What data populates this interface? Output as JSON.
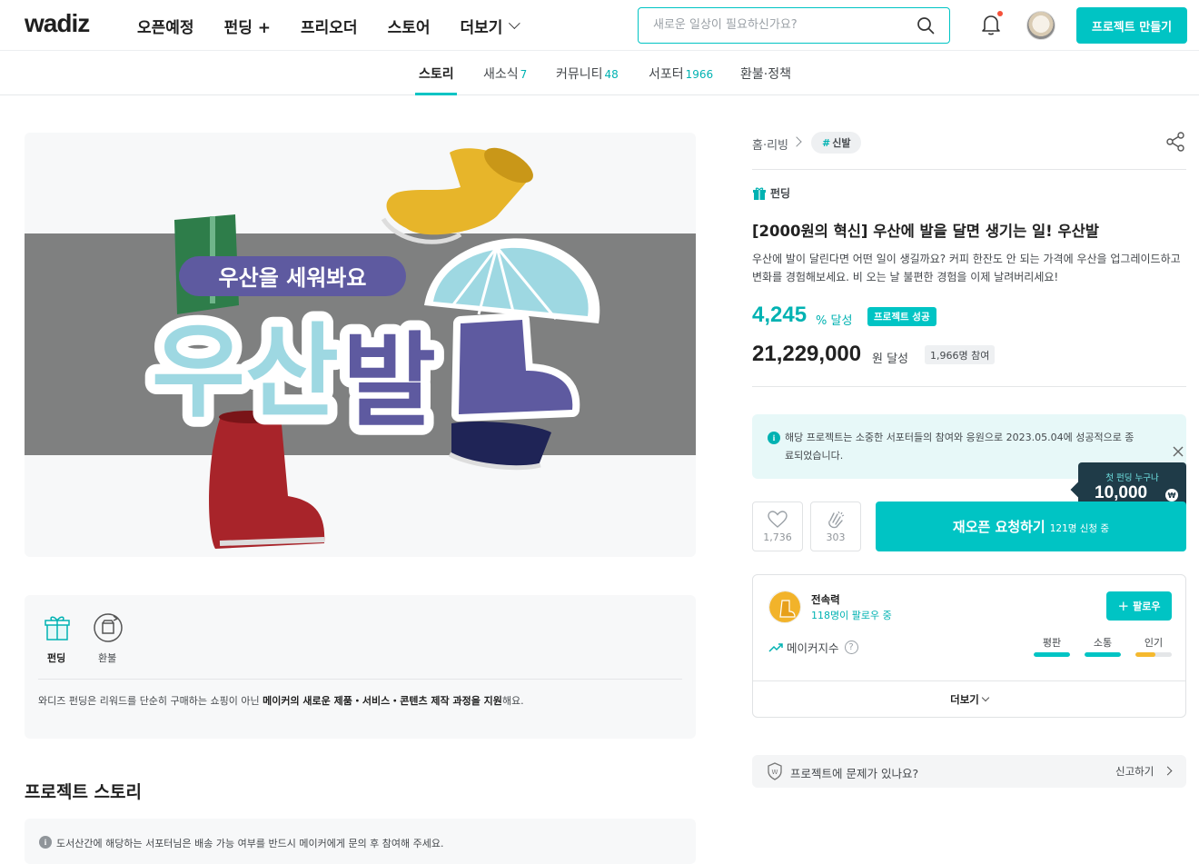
{
  "header": {
    "logo": "wadiz",
    "nav": [
      "오픈예정",
      "펀딩 +",
      "프리오더",
      "스토어",
      "더보기"
    ],
    "search_placeholder": "새로운 일상이 필요하신가요?",
    "make_project_label": "프로젝트 만들기"
  },
  "tabs": [
    {
      "label": "스토리",
      "count": ""
    },
    {
      "label": "새소식",
      "count": "7"
    },
    {
      "label": "커뮤니티",
      "count": "48"
    },
    {
      "label": "서포터",
      "count": "1966"
    },
    {
      "label": "환불·정책",
      "count": ""
    }
  ],
  "hero": {
    "badge_text": "우산을 세워봐요",
    "logo_text": "우산발"
  },
  "infobox": {
    "items": [
      "펀딩",
      "환불"
    ],
    "text_pre": "와디즈 펀딩은 리워드를 단순히 구매하는 쇼핑이 아닌 ",
    "text_bold": "메이커의 새로운 제품・서비스・콘텐츠 제작 과정을 지원",
    "text_post": "해요."
  },
  "story": {
    "title": "프로젝트 스토리",
    "notice": "도서산간에 해당하는 서포터님은 배송 가능 여부를 반드시 메이커에게 문의 후 참여해 주세요."
  },
  "project": {
    "breadcrumb": "홈·리빙",
    "tag": "신발",
    "category": "펀딩",
    "title": "[2000원의 혁신] 우산에 발을 달면 생기는 일! 우산발",
    "description": "우산에 발이 달린다면 어떤 일이 생길까요? 커피 한잔도 안 되는 가격에 우산을 업그레이드하고 변화를 경험해보세요. 비 오는 날 불편한 경험을 이제 날려버리세요!",
    "percent": "4,245",
    "percent_unit": "% 달성",
    "success_badge": "프로젝트 성공",
    "amount": "21,229,000",
    "amount_unit": "원 달성",
    "participants": "1,966명 참여",
    "done_notice": "해당 프로젝트는 소중한 서포터들의 참여와 응원으로 2023.05.04에 성공적으로 종료되었습니다.",
    "tooltip_label": "첫 펀딩 누구나",
    "tooltip_value": "10,000",
    "tooltip_currency": "₩",
    "likes": "1,736",
    "cheers": "303",
    "reopen_label": "재오픈 요청하기",
    "reopen_sub": "121명 신청 중"
  },
  "maker": {
    "name": "전속력",
    "followers": "118명이 팔로우 중",
    "follow_label": "팔로우",
    "index_label": "메이커지수",
    "metrics": [
      {
        "label": "평판",
        "value": 1.0,
        "color": "#00c4c4"
      },
      {
        "label": "소통",
        "value": 1.0,
        "color": "#00c4c4"
      },
      {
        "label": "인기",
        "value": 0.55,
        "color": "#f5b92f"
      }
    ],
    "more_label": "더보기"
  },
  "report": {
    "text": "프로젝트에 문제가 있나요?",
    "link": "신고하기"
  }
}
